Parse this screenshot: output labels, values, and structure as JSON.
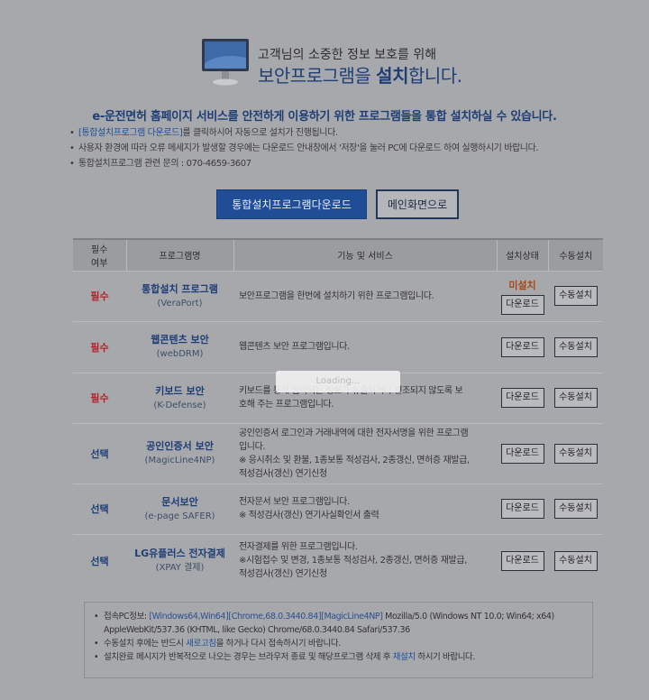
{
  "header": {
    "subtitle": "고객님의 소중한 정보 보호를 위해",
    "title_pre": "보안프로그램을 ",
    "title_bold": "설치",
    "title_post": "합니다."
  },
  "intro": "e-운전면허 홈페이지 서비스를 안전하게 이용하기 위한 프로그램들을 통합 설치하실 수 있습니다.",
  "bullets": {
    "line1_link": "[통합설치프로그램 다운로드]",
    "line1_rest": "를 클릭하시어 자동으로 설치가 진행됩니다.",
    "line2": "사용자 환경에 따라 오류 메세지가 발생할 경우에는 다운로드 안내창에서 '저장'을 눌러 PC에 다운로드 하여 실행하시기 바랍니다.",
    "line3": "통합설치프로그램 관련 문의 : 070-4659-3607"
  },
  "buttons": {
    "download_all": "통합설치프로그램다운로드",
    "main_page": "메인화면으로"
  },
  "table": {
    "headers": {
      "req_line1": "필수",
      "req_line2": "여부",
      "name": "프로그램명",
      "func": "기능 및 서비스",
      "status": "설치상태",
      "manual": "수동설치"
    },
    "download_label": "다운로드",
    "manual_label": "수동설치",
    "rows": [
      {
        "req": "필수",
        "name": "통합설치 프로그램",
        "code": "(VeraPort)",
        "desc1": "보안프로그램을 한번에 설치하기 위한 프로그램입니다.",
        "desc2": "",
        "desc3": "",
        "status": "미설치"
      },
      {
        "req": "필수",
        "name": "웹콘텐츠 보안",
        "code": "(webDRM)",
        "desc1": "웹콘텐츠 보안 프로그램입니다.",
        "desc2": "",
        "desc3": "",
        "status": ""
      },
      {
        "req": "필수",
        "name": "키보드 보안",
        "code": "(K-Defense)",
        "desc1": "키보드를 통해 입력되는 정보가 유출되거나 변조되지 않도록 보",
        "desc2": "호해 주는 프로그램입니다.",
        "desc3": "",
        "status": ""
      },
      {
        "req": "선택",
        "name": "공인인증서 보안",
        "code": "(MagicLine4NP)",
        "desc1": "공인인증서 로그인과 거래내역에 대한 전자서명을 위한 프로그램",
        "desc2": "입니다.",
        "desc3": "※ 응시취소 및 환불, 1종보통 적성검사, 2종갱신, 면허증 재발급,",
        "desc4": "적성검사(갱신) 연기신청",
        "status": ""
      },
      {
        "req": "선택",
        "name": "문서보안",
        "code": "(e-page SAFER)",
        "desc1": "전자문서 보안 프로그램입니다.",
        "desc2": "※ 적성검사(갱신) 연기사실확인서 출력",
        "desc3": "",
        "status": ""
      },
      {
        "req": "선택",
        "name": "LG유플러스 전자결제",
        "code": "(XPAY 결제)",
        "desc1": "전자결제를 위한 프로그램입니다.",
        "desc2": "※시험접수 및 변경, 1종보통 적성검사, 2종갱신, 면허증 재발급,",
        "desc3": "적성검사(갱신) 연기신청",
        "status": ""
      }
    ]
  },
  "info": {
    "pc_label": "접속PC정보: ",
    "pc_sys": "[Windows64,Win64][Chrome,68.0.3440.84][MagicLine4NP]",
    "pc_ua1": " Mozilla/5.0 (Windows NT 10.0; Win64; x64)",
    "pc_ua2": "AppleWebKit/537.36 (KHTML, like Gecko) Chrome/68.0.3440.84 Safari/537.36",
    "line2_pre": "수동설치 후에는 반드시 ",
    "line2_link": "새로고침",
    "line2_post": "을 하거나 다시 접속하시기 바랍니다.",
    "line3_pre": "설치완료 메시지가 반복적으로 나오는 경우는 브라우저 종료 및 해당프로그램 삭제 후 ",
    "line3_link": "재설치",
    "line3_post": " 하시기 바랍니다."
  },
  "overlay_text": "Loading...",
  "colors": {
    "background": "#a7a8ab",
    "brand_blue": "#1f4d96",
    "required_red": "#b3232b",
    "status_orange": "#a44b1d"
  },
  "icons": {
    "header": "monitor-icon"
  }
}
